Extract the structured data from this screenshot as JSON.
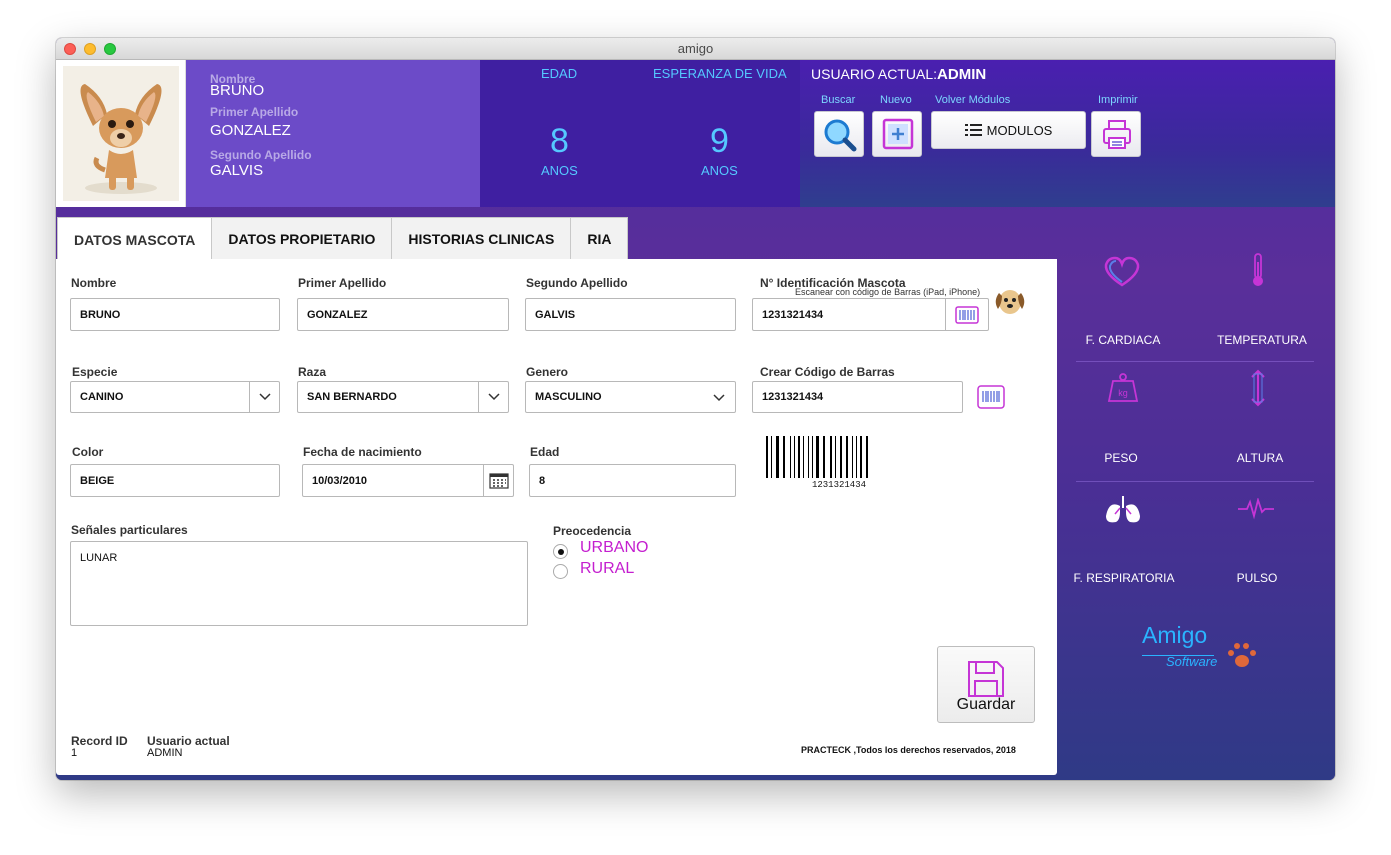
{
  "window": {
    "title": "amigo"
  },
  "header": {
    "nombre_label": "Nombre",
    "nombre": "BRUNO",
    "primer_apellido_label": "Primer Apellido",
    "primer_apellido": "GONZALEZ",
    "segundo_apellido_label": "Segundo Apellido",
    "segundo_apellido": "GALVIS",
    "edad_label": "EDAD",
    "edad_value": "8",
    "edad_unit": "ANOS",
    "esperanza_label": "ESPERANZA DE VIDA",
    "esperanza_value": "9",
    "esperanza_unit": "ANOS",
    "usuario_label": "USUARIO ACTUAL:",
    "usuario_value": "ADMIN"
  },
  "toolbar": {
    "buscar": "Buscar",
    "nuevo": "Nuevo",
    "volver": "Volver Módulos",
    "modulos": "MODULOS",
    "imprimir": "Imprimir"
  },
  "tabs": [
    {
      "label": "DATOS MASCOTA"
    },
    {
      "label": "DATOS PROPIETARIO"
    },
    {
      "label": "HISTORIAS CLINICAS"
    },
    {
      "label": "RIA"
    }
  ],
  "form": {
    "nombre_label": "Nombre",
    "nombre": "BRUNO",
    "primer_apellido_label": "Primer Apellido",
    "primer_apellido": "GONZALEZ",
    "segundo_apellido_label": "Segundo Apellido",
    "segundo_apellido": "GALVIS",
    "id_label": "N°  Identificación Mascota",
    "id_hint": "Escanear con código de Barras (iPad, iPhone)",
    "id_value": "1231321434",
    "especie_label": "Especie",
    "especie": "CANINO",
    "raza_label": "Raza",
    "raza": "SAN BERNARDO",
    "genero_label": "Genero",
    "genero": "MASCULINO",
    "crear_label": "Crear Código de Barras",
    "crear_value": "1231321434",
    "color_label": "Color",
    "color": "BEIGE",
    "fecha_label": "Fecha de nacimiento",
    "fecha": "10/03/2010",
    "edad_label": "Edad",
    "edad": "8",
    "barcode_text": "1231321434",
    "senales_label": "Señales particulares",
    "senales": "LUNAR",
    "procedencia_label": "Preocedencia",
    "urbano": "URBANO",
    "rural": "RURAL",
    "guardar": "Guardar"
  },
  "footer": {
    "record_label": "Record ID",
    "record_value": "1",
    "usuario_label": "Usuario actual",
    "usuario_value": "ADMIN",
    "copyright": "PRACTECK ,Todos los derechos reservados, 2018"
  },
  "vitals": {
    "cardiaca": "F. CARDIACA",
    "temperatura": "TEMPERATURA",
    "peso": "PESO",
    "peso_unit": "kg",
    "altura": "ALTURA",
    "respiratoria": "F. RESPIRATORIA",
    "pulso": "PULSO"
  },
  "brand": {
    "name": "Amigo",
    "sub": "Software"
  },
  "colors": {
    "accent": "#55c8ff",
    "radio_text": "#c41ecf",
    "header_purple": "#6c4bc8"
  }
}
